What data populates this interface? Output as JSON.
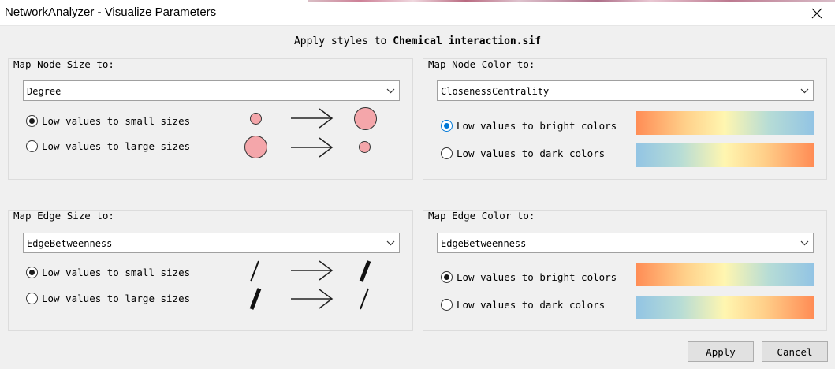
{
  "window": {
    "title": "NetworkAnalyzer - Visualize Parameters"
  },
  "headline": {
    "prefix": "Apply styles to ",
    "file": "Chemical interaction.sif"
  },
  "node_size": {
    "title": "Map Node Size to:",
    "selected": "Degree",
    "options": [
      {
        "label": "Low values to small sizes",
        "checked": true
      },
      {
        "label": "Low values to large sizes",
        "checked": false
      }
    ]
  },
  "node_color": {
    "title": "Map Node Color to:",
    "selected": "ClosenessCentrality",
    "options": [
      {
        "label": "Low values to bright colors",
        "checked": true
      },
      {
        "label": "Low values to dark colors",
        "checked": false
      }
    ]
  },
  "edge_size": {
    "title": "Map Edge Size to:",
    "selected": "EdgeBetweenness",
    "options": [
      {
        "label": "Low values to small sizes",
        "checked": true
      },
      {
        "label": "Low values to large sizes",
        "checked": false
      }
    ]
  },
  "edge_color": {
    "title": "Map Edge Color to:",
    "selected": "EdgeBetweenness",
    "options": [
      {
        "label": "Low values to bright colors",
        "checked": true
      },
      {
        "label": "Low values to dark colors",
        "checked": false
      }
    ]
  },
  "buttons": {
    "apply": "Apply",
    "cancel": "Cancel"
  },
  "colors": {
    "node_fill": "#f4a6aa",
    "gradient_warm": "#ff8c55",
    "gradient_mid": "#fff6b0",
    "gradient_cool": "#92c4e4",
    "radio_accent": "#0078d7"
  },
  "icons": {
    "close": "close-icon",
    "dropdown": "chevron-down-icon",
    "arrow": "right-arrow-icon"
  }
}
